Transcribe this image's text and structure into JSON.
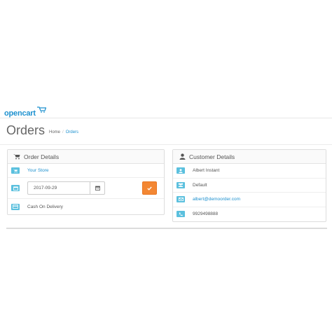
{
  "brand": {
    "logo_text": "opencart",
    "color": "#1e91cf"
  },
  "page": {
    "title": "Orders",
    "breadcrumb": [
      {
        "label": "Home"
      },
      {
        "label": "Orders"
      }
    ]
  },
  "order_details": {
    "heading": "Order Details",
    "icon": "shopping-cart-icon",
    "store": {
      "icon": "shopping-cart-icon",
      "label": "Your Store"
    },
    "date": {
      "icon": "calendar-icon",
      "value": "2017-09-29"
    },
    "confirm_button": {
      "icon": "check-icon",
      "color": "#f38733"
    },
    "payment": {
      "icon": "credit-card-icon",
      "label": "Cash On Delivery"
    }
  },
  "customer_details": {
    "heading": "Customer Details",
    "icon": "user-icon",
    "name": {
      "icon": "user-icon",
      "value": "Albert Instant"
    },
    "group": {
      "icon": "group-icon",
      "value": "Default"
    },
    "email": {
      "icon": "envelope-icon",
      "value": "albert@demoorder.com"
    },
    "phone": {
      "icon": "phone-icon",
      "value": "9929498888"
    }
  },
  "colors": {
    "badge": "#5bc0de",
    "accent": "#f38733",
    "link": "#1e91cf"
  }
}
